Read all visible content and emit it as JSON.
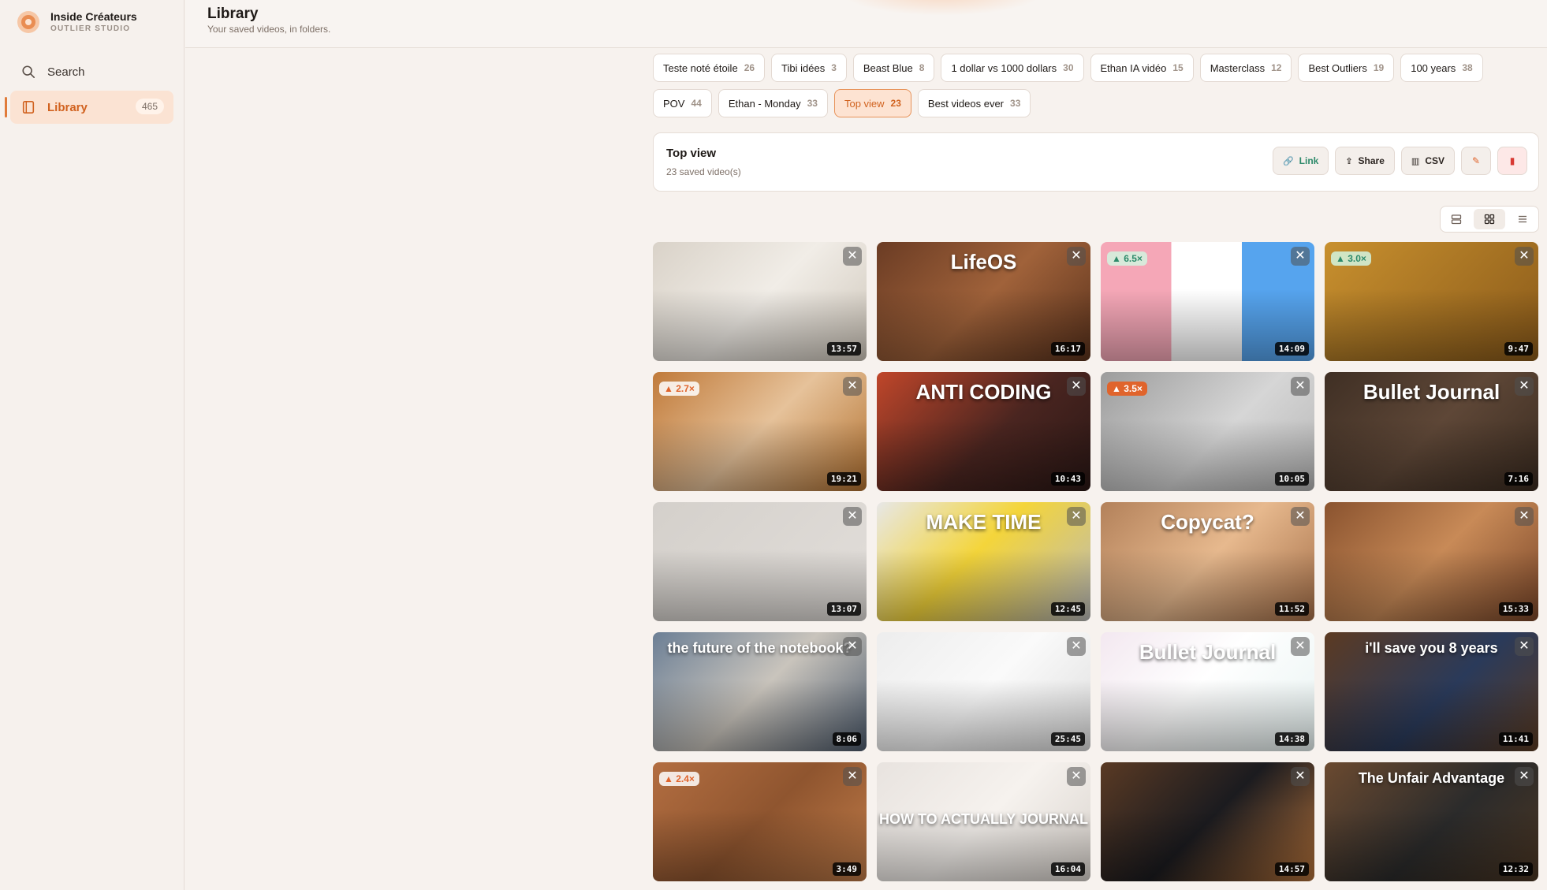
{
  "brand": {
    "name": "Inside Créateurs",
    "sub": "OUTLIER STUDIO"
  },
  "nav": {
    "search_label": "Search",
    "library_label": "Library",
    "library_count": "465"
  },
  "header": {
    "title": "Library",
    "subtitle": "Your saved videos, in folders."
  },
  "folders_row1": [
    {
      "name": "Teste noté étoile",
      "count": "26"
    },
    {
      "name": "Tibi idées",
      "count": "3"
    },
    {
      "name": "Beast Blue",
      "count": "8"
    },
    {
      "name": "1 dollar vs 1000 dollars",
      "count": "30"
    },
    {
      "name": "Ethan IA vidéo",
      "count": "15"
    },
    {
      "name": "Masterclass",
      "count": "12"
    },
    {
      "name": "Best Outliers",
      "count": "19"
    },
    {
      "name": "100 years",
      "count": "38"
    }
  ],
  "folders_row2": [
    {
      "name": "POV",
      "count": "44"
    },
    {
      "name": "Ethan - Monday",
      "count": "33"
    },
    {
      "name": "Top view",
      "count": "23",
      "active": true
    },
    {
      "name": "Best videos ever",
      "count": "33"
    }
  ],
  "folder": {
    "title": "Top view",
    "count_text": "23 saved video(s)",
    "link_label": "Link",
    "share_label": "Share",
    "csv_label": "CSV"
  },
  "colors": {
    "accent": "#e07b3a",
    "active_bg": "#fde3d2",
    "link_green": "#2d8a6a",
    "delete_red": "#d83a34"
  },
  "videos": [
    {
      "duration": "13:57",
      "bg": "linear-gradient(135deg,#d9d2c8,#f1ede7 50%,#cfc7bb)",
      "title": "",
      "badge": ""
    },
    {
      "duration": "16:17",
      "bg": "linear-gradient(135deg,#6b3c24,#a0623a 50%,#5a321c)",
      "title": "LifeOS",
      "badge": ""
    },
    {
      "duration": "14:09",
      "bg": "linear-gradient(90deg,#f5a7b7 0 33%,#ffffff 33% 66%,#56a4ee 66%)",
      "title": "",
      "badge": "▲ 6.5×"
    },
    {
      "duration": "9:47",
      "bg": "linear-gradient(135deg,#c8902e,#8a5a1a)",
      "title": "",
      "badge": "▲ 3.0×"
    },
    {
      "duration": "19:21",
      "bg": "linear-gradient(135deg,#c07a3a,#e6c29a 50%,#b3712f)",
      "title": "",
      "badge": "▲ 2.7×"
    },
    {
      "duration": "10:43",
      "bg": "linear-gradient(135deg,#c0462a,#4a2520 55%,#2a1715)",
      "title": "ANTI CODING",
      "badge": ""
    },
    {
      "duration": "10:05",
      "bg": "linear-gradient(135deg,#9c9c9c,#d6d6d6 55%,#b6b6b6)",
      "title": "",
      "badge": "▲ 3.5×"
    },
    {
      "duration": "7:16",
      "bg": "linear-gradient(135deg,#3f2f24,#5e4737 50%,#3a2b20)",
      "title": "Bullet Journal",
      "badge": ""
    },
    {
      "duration": "13:07",
      "bg": "linear-gradient(135deg,#d4d0cb,#e2deda)",
      "title": "",
      "badge": ""
    },
    {
      "duration": "12:45",
      "bg": "linear-gradient(135deg,#e7e7e7,#f4d53a 45%,#b9b9b9)",
      "title": "MAKE TIME",
      "badge": ""
    },
    {
      "duration": "11:52",
      "bg": "linear-gradient(135deg,#b3815a,#e7b98e 50%,#a56f48)",
      "title": "Copycat?",
      "badge": ""
    },
    {
      "duration": "15:33",
      "bg": "linear-gradient(135deg,#8a532f,#c88a57 50%,#7a4629)",
      "title": "",
      "badge": ""
    },
    {
      "duration": "8:06",
      "bg": "linear-gradient(135deg,#6c7f95,#c9c4bc 50%,#4d5b6d)",
      "title": "the future of the notebook?",
      "badge": ""
    },
    {
      "duration": "25:45",
      "bg": "linear-gradient(135deg,#ededed,#fafafa 50%,#dedede)",
      "title": "",
      "badge": ""
    },
    {
      "duration": "14:38",
      "bg": "linear-gradient(135deg,#f3e8f0,#ffffff 45%,#e8f3f2)",
      "title": "Bullet Journal",
      "badge": ""
    },
    {
      "duration": "11:41",
      "bg": "linear-gradient(135deg,#5c3a22,#2a3a5a 55%,#5b3b22)",
      "title": "i'll save you 8 years",
      "badge": ""
    },
    {
      "duration": "3:49",
      "bg": "linear-gradient(135deg,#b36e41,#8f552f 50%,#c07b48)",
      "title": "",
      "badge": "▲ 2.4×"
    },
    {
      "duration": "16:04",
      "bg": "linear-gradient(135deg,#e8e3df,#f6f2ee 50%,#d9d3cd)",
      "title": "HOW TO ACTUALLY JOURNAL",
      "badge": ""
    },
    {
      "duration": "14:57",
      "bg": "linear-gradient(135deg,#5a3a24,#1b1b1f 50%,#b3713a)",
      "title": "",
      "badge": ""
    },
    {
      "duration": "12:32",
      "bg": "linear-gradient(135deg,#6b4a30,#2b2b2b 55%,#4b3623)",
      "title": "The Unfair Advantage",
      "badge": ""
    }
  ]
}
